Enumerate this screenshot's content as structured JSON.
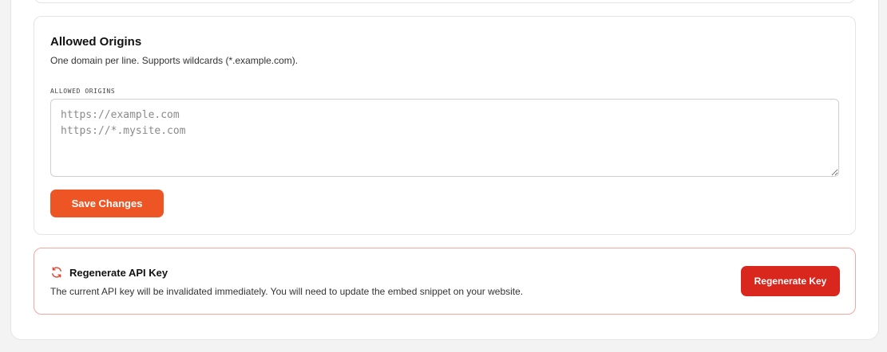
{
  "allowed_origins": {
    "title": "Allowed Origins",
    "description": "One domain per line. Supports wildcards (*.example.com).",
    "field_label": "ALLOWED ORIGINS",
    "field_value": "",
    "field_placeholder": "https://example.com\nhttps://*.mysite.com",
    "save_label": "Save Changes"
  },
  "regenerate": {
    "icon": "refresh-icon",
    "title": "Regenerate API Key",
    "description": "The current API key will be invalidated immediately. You will need to update the embed snippet on your website.",
    "button_label": "Regenerate Key"
  },
  "colors": {
    "accent": "#ee5524",
    "danger": "#d9271e",
    "danger_border": "#f0a8a0"
  }
}
